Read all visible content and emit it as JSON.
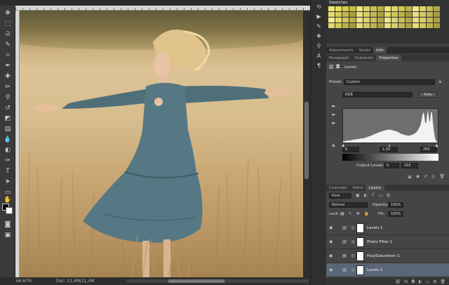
{
  "status": {
    "zoom": "66.67%",
    "doc": "Doc: 11,4M/11,4M"
  },
  "swatches": {
    "title": "Swatches",
    "colors": [
      "#f2e86a",
      "#e6dc55",
      "#d8cd48",
      "#c9c03e",
      "#f3ea80",
      "#dad16b",
      "#cabf53",
      "#b6ac46",
      "#efe478",
      "#e1d764",
      "#d2c84f",
      "#bfb544",
      "#f1e989",
      "#ddd370",
      "#c8be56",
      "#b2a947",
      "#e8df6c",
      "#d5cb58",
      "#c4ba4b",
      "#aba03d",
      "#ece37c",
      "#d8cf66",
      "#c2b853",
      "#a99f44",
      "#e4da66",
      "#d0c652",
      "#bcb246",
      "#a49a3a",
      "#ebe180",
      "#d4ca66",
      "#bfb552",
      "#a69c42",
      "#f4ec8c",
      "#e3d96f",
      "#cfc55a",
      "#b9af4a",
      "#ede488",
      "#dcd36f",
      "#c7bd5b",
      "#b0a649",
      "#f0e893",
      "#ddd47a",
      "#c9bf62",
      "#b2a84e",
      "#e9e084",
      "#d7ce6c",
      "#c2b859",
      "#aca246",
      "#e3da70",
      "#d2c85c",
      "#bcb24b",
      "#a59b3e",
      "#e9e07c",
      "#d5cb64",
      "#c0b651",
      "#a89e42",
      "#ece383",
      "#d9d06b",
      "#c3b957",
      "#ada346",
      "#e5dc73",
      "#d1c75e",
      "#bdb34d",
      "#a79d40"
    ]
  },
  "tabs": {
    "adjust": [
      "Adjustments",
      "Styles",
      "Info"
    ],
    "props": [
      "Paragraph",
      "Character",
      "Properties"
    ],
    "layers": [
      "Channels",
      "Paths",
      "Layers"
    ]
  },
  "properties": {
    "title": "Levels",
    "preset_label": "Preset:",
    "preset_value": "Custom",
    "channel_value": "RGB",
    "auto_label": "Auto",
    "input_black": "0",
    "input_gamma": "1,00",
    "input_white": "255",
    "output_label": "Output Levels:",
    "output_black": "0",
    "output_white": "255"
  },
  "layers_panel": {
    "kind_label": "Kind",
    "blend_mode": "Normal",
    "opacity_label": "Opacity:",
    "opacity_value": "100%",
    "lock_label": "Lock:",
    "fill_label": "Fill:",
    "fill_value": "100%",
    "layers": [
      {
        "name": "Levels 1",
        "selected": false
      },
      {
        "name": "Photo Filter 1",
        "selected": false
      },
      {
        "name": "Hue/Saturation 1",
        "selected": false
      },
      {
        "name": "Levels 2",
        "selected": true
      }
    ]
  },
  "histogram": [
    2,
    2,
    2,
    2,
    3,
    3,
    3,
    3,
    3,
    4,
    4,
    4,
    4,
    5,
    5,
    5,
    5,
    6,
    6,
    6,
    6,
    6,
    7,
    7,
    8,
    8,
    9,
    9,
    10,
    10,
    11,
    12,
    12,
    13,
    13,
    14,
    15,
    15,
    16,
    16,
    17,
    17,
    18,
    18,
    18,
    19,
    19,
    19,
    19,
    19,
    18,
    18,
    18,
    17,
    17,
    16,
    16,
    15,
    14,
    13,
    13,
    12,
    12,
    11,
    11,
    11,
    10,
    10,
    10,
    11,
    11,
    12,
    12,
    13,
    14,
    15,
    17,
    19,
    22,
    25,
    30,
    38,
    45,
    42,
    30,
    28,
    40,
    48,
    35,
    30,
    44,
    46,
    30,
    18,
    8,
    3,
    1
  ]
}
